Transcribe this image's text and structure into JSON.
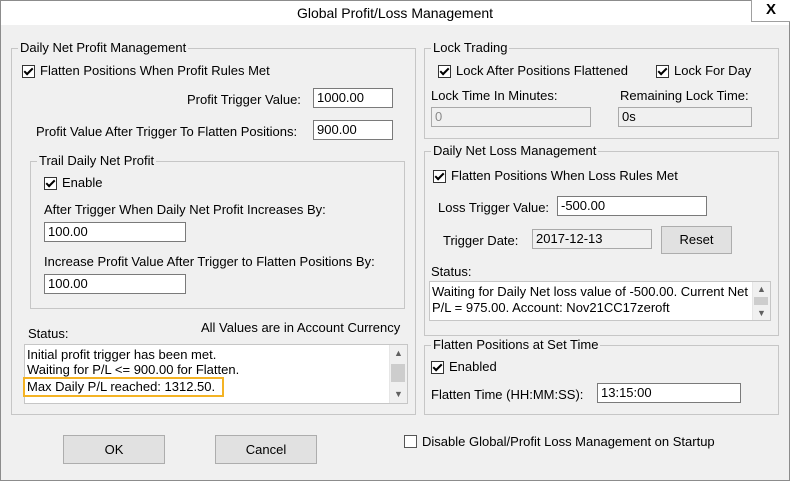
{
  "window": {
    "title": "Global Profit/Loss Management",
    "close_glyph": "X"
  },
  "profit": {
    "legend": "Daily Net Profit Management",
    "flatten_label": "Flatten Positions When Profit Rules Met",
    "trigger_label": "Profit Trigger Value:",
    "trigger_value": "1000.00",
    "after_label": "Profit Value After Trigger To Flatten Positions:",
    "after_value": "900.00",
    "trail": {
      "legend": "Trail Daily Net Profit",
      "enable_label": "Enable",
      "increase_label": "After Trigger When Daily Net Profit Increases By:",
      "increase_value": "100.00",
      "increase2_label": "Increase Profit Value After Trigger to Flatten Positions By:",
      "increase2_value": "100.00"
    },
    "status_label": "Status:",
    "currency_note": "All Values are in Account Currency",
    "status_lines": [
      "Initial profit trigger has been met.",
      "Waiting for P/L <= 900.00 for Flatten.",
      "Max Daily P/L reached: 1312.50."
    ]
  },
  "lock": {
    "legend": "Lock Trading",
    "after_flatten_label": "Lock After Positions Flattened",
    "for_day_label": "Lock For Day",
    "minutes_label": "Lock Time In Minutes:",
    "minutes_value": "0",
    "remaining_label": "Remaining Lock Time:",
    "remaining_value": "0s"
  },
  "loss": {
    "legend": "Daily Net Loss Management",
    "flatten_label": "Flatten Positions When Loss Rules Met",
    "trigger_label": "Loss Trigger Value:",
    "trigger_value": "-500.00",
    "date_label": "Trigger Date:",
    "date_value": "2017-12-13",
    "reset_label": "Reset",
    "status_label": "Status:",
    "status_lines": [
      "Waiting for Daily Net loss value of -500.00.  Current Net",
      "P/L = 975.00.  Account: Nov21CC17zeroft"
    ]
  },
  "settime": {
    "legend": "Flatten Positions at Set Time",
    "enabled_label": "Enabled",
    "time_label": "Flatten Time (HH:MM:SS):",
    "time_value": "13:15:00"
  },
  "footer": {
    "ok_label": "OK",
    "cancel_label": "Cancel",
    "disable_label": "Disable Global/Profit Loss Management on Startup"
  }
}
